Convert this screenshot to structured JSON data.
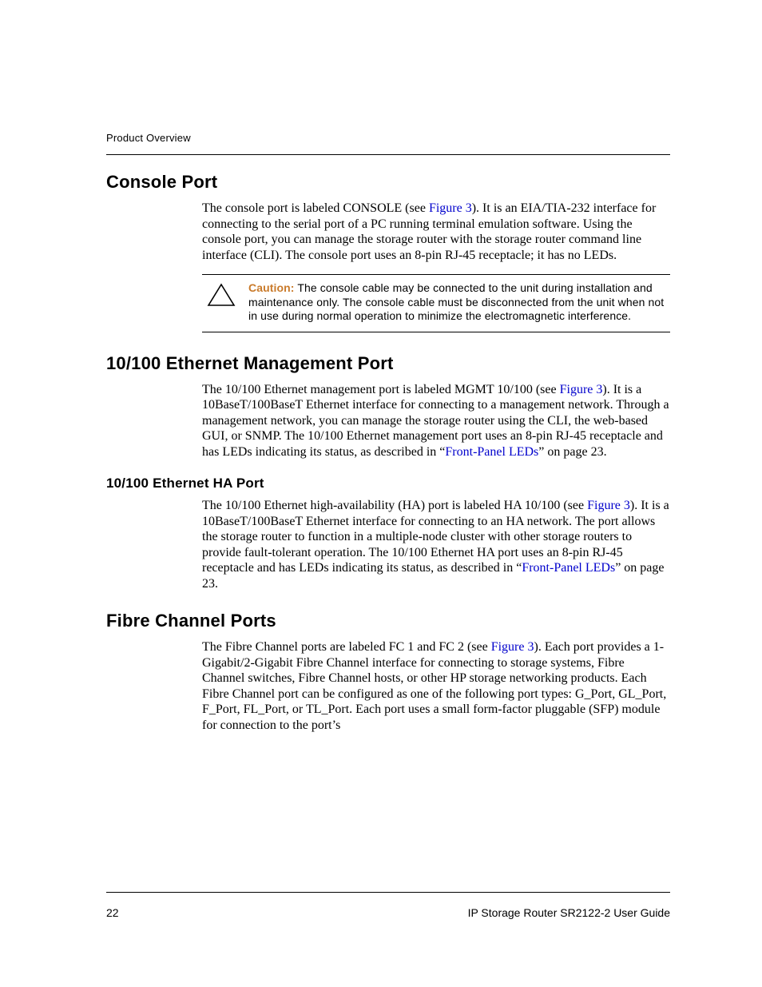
{
  "header": {
    "section_title": "Product Overview"
  },
  "sections": {
    "console_port": {
      "heading": "Console Port",
      "para_a": "The console port is labeled CONSOLE (see ",
      "link1": "Figure 3",
      "para_b": "). It is an EIA/TIA-232 interface for connecting to the serial port of a PC running terminal emulation software. Using the console port, you can manage the storage router with the storage router command line interface (CLI). The console port uses an 8-pin RJ-45 receptacle; it has no LEDs.",
      "caution_label": "Caution:",
      "caution_text": "  The console cable may be connected to the unit during installation and maintenance only. The console cable must be disconnected from the unit when not in use during normal operation to minimize the electromagnetic interference."
    },
    "mgmt_port": {
      "heading": "10/100 Ethernet Management Port",
      "para_a": "The 10/100 Ethernet management port is labeled MGMT 10/100 (see ",
      "link1": "Figure 3",
      "para_b": "). It is a 10BaseT/100BaseT Ethernet interface for connecting to a management network. Through a management network, you can manage the storage router using the CLI, the web-based GUI, or SNMP. The 10/100 Ethernet management port uses an 8-pin RJ-45 receptacle and has LEDs indicating its status, as described in “",
      "link2": "Front-Panel LEDs",
      "para_c": "” on page 23."
    },
    "ha_port": {
      "heading": "10/100 Ethernet HA Port",
      "para_a": "The 10/100 Ethernet high-availability (HA) port is labeled HA 10/100 (see ",
      "link1": "Figure 3",
      "para_b": "). It is a 10BaseT/100BaseT Ethernet interface for connecting to an HA network. The port allows the storage router to function in a multiple-node cluster with other storage routers to provide fault-tolerant operation. The 10/100 Ethernet HA port uses an 8-pin RJ-45 receptacle and has LEDs indicating its status, as described in “",
      "link2": "Front-Panel LEDs",
      "para_c": "” on page 23."
    },
    "fc_ports": {
      "heading": "Fibre Channel Ports",
      "para_a": "The Fibre Channel ports are labeled FC 1 and FC 2 (see ",
      "link1": "Figure 3",
      "para_b": "). Each port provides a 1-Gigabit/2-Gigabit Fibre Channel interface for connecting to storage systems, Fibre Channel switches, Fibre Channel hosts, or other HP storage networking products. Each Fibre Channel port can be configured as one of the following port types: G_Port, GL_Port, F_Port, FL_Port, or TL_Port. Each port uses a small form-factor pluggable (SFP) module for connection to the port’s"
    }
  },
  "footer": {
    "page_number": "22",
    "doc_title": "IP Storage Router SR2122-2 User Guide"
  }
}
